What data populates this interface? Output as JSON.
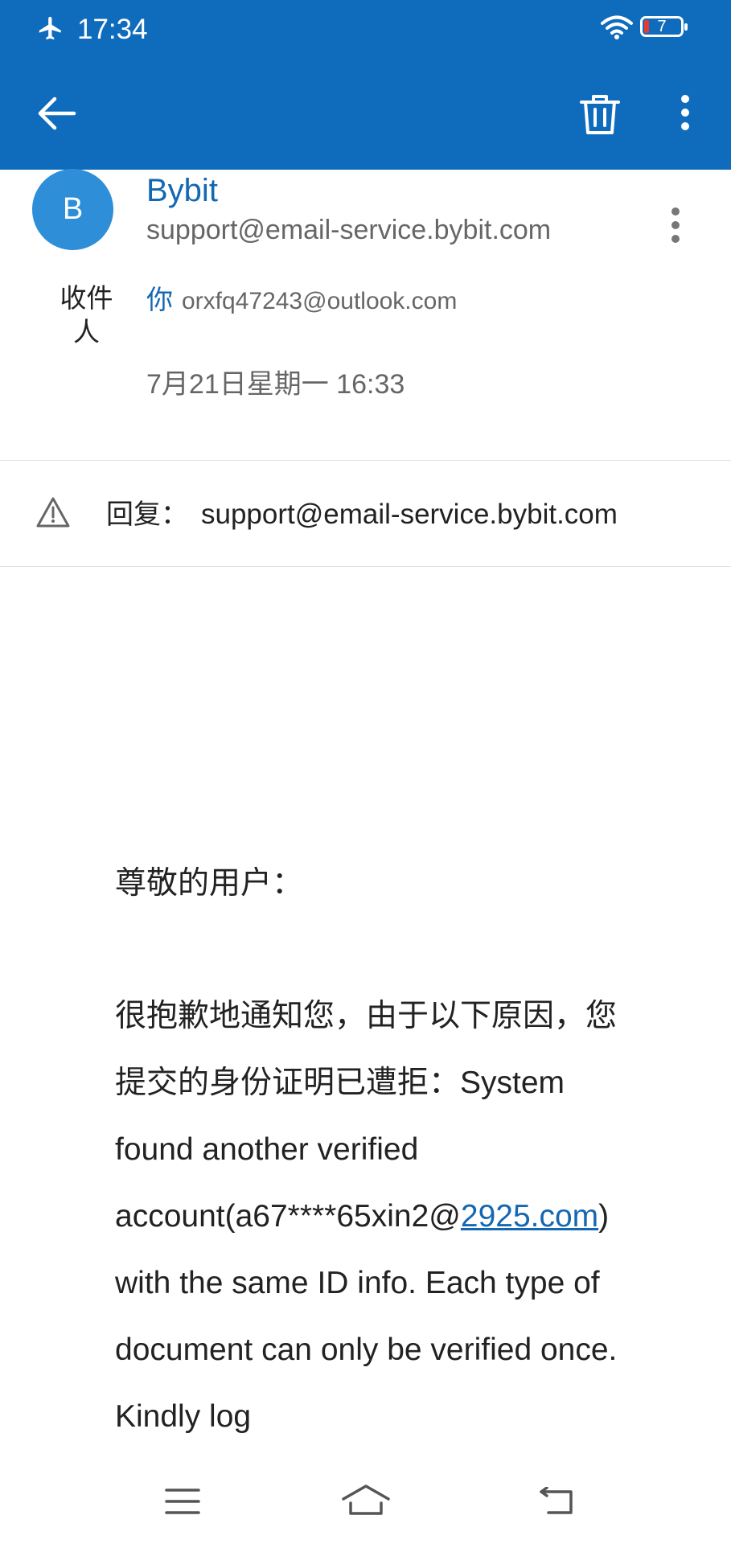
{
  "status_bar": {
    "time": "17:34",
    "battery_level": "7",
    "icons": [
      "airplane-mode-icon",
      "wifi-icon",
      "battery-icon"
    ]
  },
  "app_bar": {
    "icons": [
      "back-arrow-icon",
      "delete-trash-icon",
      "more-vertical-icon"
    ],
    "background_color": "#0f6cbd"
  },
  "sender": {
    "avatar_initial": "B",
    "name": "Bybit",
    "email": "support@email-service.bybit.com",
    "avatar_color": "#2e8fd8"
  },
  "recipients": {
    "label": "收件人",
    "you": "你",
    "address": "orxfq47243@outlook.com"
  },
  "date": "7月21日星期一 16:33",
  "reply_to": {
    "label": "回复：",
    "address": "support@email-service.bybit.com",
    "icon": "warning-triangle-icon"
  },
  "body": {
    "greeting": "尊敬的用户：",
    "paragraph_before_link": "很抱歉地通知您，由于以下原因，您提交的身份证明已遭拒：System found another verified account(a67****65xin2@",
    "link": "2925.com",
    "paragraph_after_link": ") with the same ID info. Each type of document can only be verified once. Kindly log"
  },
  "nav_bar": {
    "icons": [
      "menu-icon",
      "home-icon",
      "back-icon"
    ]
  },
  "colors": {
    "accent": "#1467b3",
    "secondary_text": "#666666"
  }
}
